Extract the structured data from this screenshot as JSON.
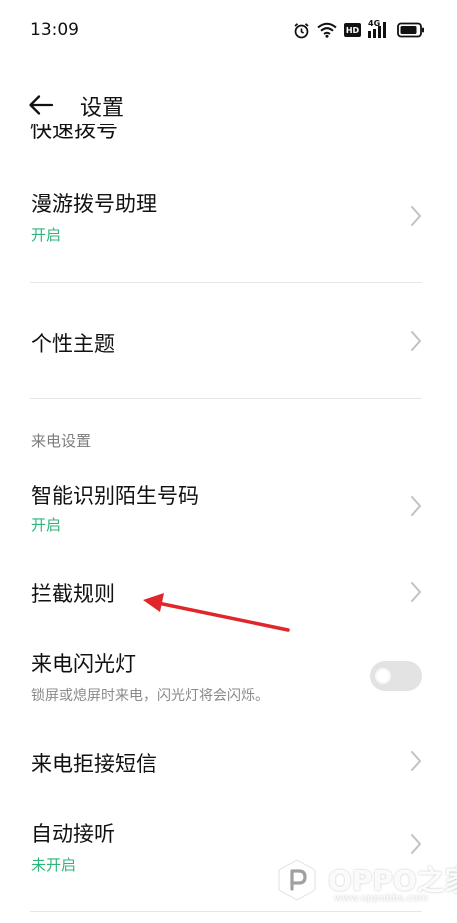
{
  "status_bar": {
    "time": "13:09",
    "icons": [
      "alarm-icon",
      "wifi-icon",
      "hd-icon",
      "4g-signal-icon",
      "battery-icon"
    ],
    "hd_label": "HD",
    "network_label": "4G"
  },
  "header": {
    "title": "设置"
  },
  "clipped_item": {
    "title": "快速拨号"
  },
  "items": {
    "roaming": {
      "title": "漫游拨号助理",
      "status": "开启"
    },
    "theme": {
      "title": "个性主题"
    },
    "smart_identify": {
      "title": "智能识别陌生号码",
      "status": "开启"
    },
    "block_rules": {
      "title": "拦截规则"
    },
    "flash": {
      "title": "来电闪光灯",
      "description": "锁屏或熄屏时来电，闪光灯将会闪烁。",
      "enabled": false
    },
    "reject_sms": {
      "title": "来电拒接短信"
    },
    "auto_answer": {
      "title": "自动接听",
      "status": "未开启"
    }
  },
  "section": {
    "incoming_call": "来电设置"
  },
  "watermark": {
    "brand": "OPPO之家",
    "url": "www.oppobbs.com"
  },
  "colors": {
    "accent_green": "#2db57a",
    "annotation_red": "#e0262b"
  }
}
